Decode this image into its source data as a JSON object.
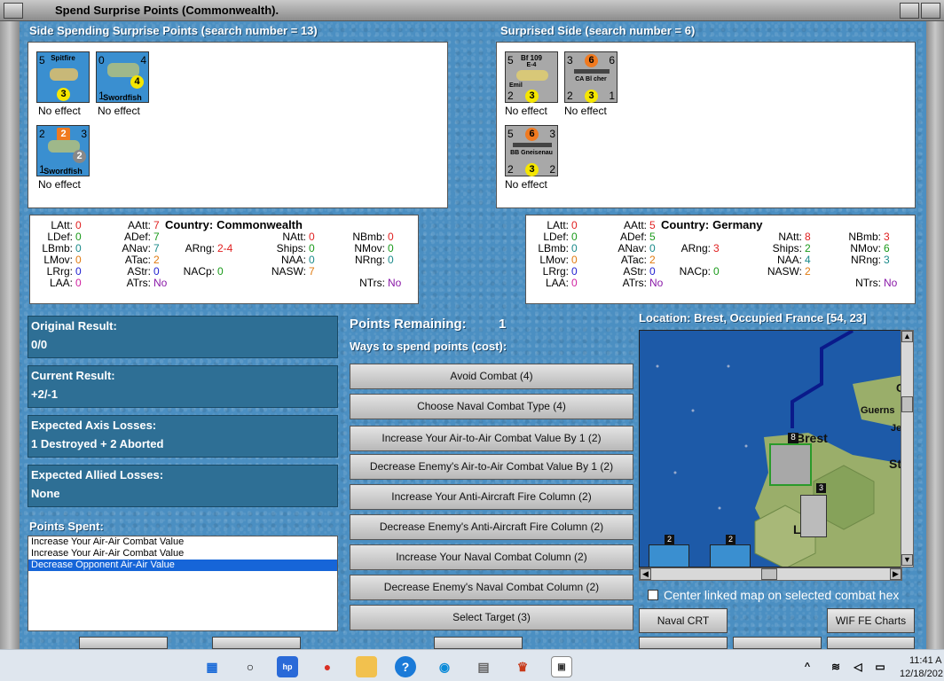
{
  "window": {
    "title": "Spend Surprise Points (Commonwealth)."
  },
  "spending_side": {
    "title": "Side Spending Surprise Points (search number = 13)",
    "units": [
      {
        "name": "Spitfire",
        "tl": "5",
        "mid": "3",
        "effect": "No effect"
      },
      {
        "name": "Swordfish",
        "tl": "0",
        "tr": "4",
        "mid": "4",
        "bl": "1",
        "effect": "No effect"
      },
      {
        "name": "Swordfish",
        "tl": "2",
        "tc": "2",
        "tr": "3",
        "mid": "2",
        "bl": "1",
        "effect": "No effect"
      }
    ]
  },
  "surprised_side": {
    "title": "Surprised Side (search number = 6)",
    "units": [
      {
        "name": "Bf 109",
        "sub": "E-4",
        "extra": "Emil",
        "tl": "5",
        "bl": "2",
        "mid": "3",
        "effect": "No effect"
      },
      {
        "name": "CA Bl cher",
        "tl": "3",
        "tc": "6",
        "tr": "6",
        "bl": "2",
        "mid": "3",
        "br": "1",
        "effect": "No effect"
      },
      {
        "name": "BB Gneisenau",
        "tl": "5",
        "tc": "6",
        "tr": "3",
        "bl": "2",
        "mid": "3",
        "br": "2",
        "effect": "No effect"
      }
    ]
  },
  "stats_left": {
    "country_label": "Country:",
    "country": "Commonwealth",
    "col1": [
      [
        "LAtt:",
        "0"
      ],
      [
        "LDef:",
        "0"
      ],
      [
        "LBmb:",
        "0"
      ],
      [
        "LMov:",
        "0"
      ],
      [
        "LRrg:",
        "0"
      ],
      [
        "LAA:",
        "0"
      ]
    ],
    "col2": [
      [
        "AAtt:",
        "7"
      ],
      [
        "ADef:",
        "7"
      ],
      [
        "ANav:",
        "7"
      ],
      [
        "ATac:",
        "2"
      ],
      [
        "AStr:",
        "0"
      ],
      [
        "ATrs:",
        "No"
      ]
    ],
    "col3": [
      [
        "ARng:",
        "2-4"
      ],
      [
        "NACp:",
        "0"
      ]
    ],
    "col4": [
      [
        "NAtt:",
        "0"
      ],
      [
        "Ships:",
        "0"
      ],
      [
        "NAA:",
        "0"
      ],
      [
        "NASW:",
        "7"
      ]
    ],
    "col5": [
      [
        "NBmb:",
        "0"
      ],
      [
        "NMov:",
        "0"
      ],
      [
        "NRng:",
        "0"
      ],
      [
        "NTrs:",
        "No"
      ]
    ]
  },
  "stats_right": {
    "country_label": "Country:",
    "country": "Germany",
    "col1": [
      [
        "LAtt:",
        "0"
      ],
      [
        "LDef:",
        "0"
      ],
      [
        "LBmb:",
        "0"
      ],
      [
        "LMov:",
        "0"
      ],
      [
        "LRrg:",
        "0"
      ],
      [
        "LAA:",
        "0"
      ]
    ],
    "col2": [
      [
        "AAtt:",
        "5"
      ],
      [
        "ADef:",
        "5"
      ],
      [
        "ANav:",
        "0"
      ],
      [
        "ATac:",
        "2"
      ],
      [
        "AStr:",
        "0"
      ],
      [
        "ATrs:",
        "No"
      ]
    ],
    "col3": [
      [
        "ARng:",
        "3"
      ],
      [
        "NACp:",
        "0"
      ]
    ],
    "col4": [
      [
        "NAtt:",
        "8"
      ],
      [
        "Ships:",
        "2"
      ],
      [
        "NAA:",
        "4"
      ],
      [
        "NASW:",
        "2"
      ]
    ],
    "col5": [
      [
        "NBmb:",
        "3"
      ],
      [
        "NMov:",
        "6"
      ],
      [
        "NRng:",
        "3"
      ],
      [
        "NTrs:",
        "No"
      ]
    ]
  },
  "results": {
    "original_label": "Original Result:",
    "original_value": "0/0",
    "current_label": "Current Result:",
    "current_value": "+2/-1",
    "axis_label": "Expected Axis Losses:",
    "axis_value": "1 Destroyed + 2 Aborted",
    "allied_label": "Expected Allied Losses:",
    "allied_value": "None"
  },
  "points_spent": {
    "label": "Points Spent:",
    "items": [
      "Increase Your Air-Air Combat Value",
      "Increase Your Air-Air Combat Value",
      "Decrease Opponent Air-Air Value"
    ]
  },
  "points": {
    "remaining_label": "Points Remaining:",
    "remaining_value": "1",
    "ways_label": "Ways to spend points (cost):"
  },
  "cost_buttons": [
    "Avoid Combat (4)",
    "Choose Naval Combat Type (4)",
    "Increase Your Air-to-Air Combat Value By 1 (2)",
    "Decrease Enemy's Air-to-Air Combat Value By 1 (2)",
    "Increase Your Anti-Aircraft Fire Column (2)",
    "Decrease Enemy's Anti-Aircraft Fire Column (2)",
    "Increase Your Naval Combat Column (2)",
    "Decrease Enemy's Naval Combat Column (2)",
    "Select Target (3)"
  ],
  "map": {
    "location": "Location: Brest, Occupied France [54, 23]",
    "labels": {
      "brest": "Brest",
      "guerns": "Guerns",
      "je": "Je",
      "st": "St",
      "c": "C",
      "l": "L"
    },
    "unit_counts": {
      "a": "8",
      "b": "3",
      "c": "2",
      "d": "2"
    },
    "center_label": "Center linked map on selected combat hex"
  },
  "bottom_buttons": {
    "naval_crt": "Naval CRT",
    "wif_charts": "WIF FE Charts"
  },
  "taskbar": {
    "time": "11:41 A",
    "date": "12/18/202"
  },
  "colors": {
    "panel_blue": "#2e6f95",
    "zero_red": "#e02020",
    "green": "#1a9a1a",
    "teal": "#1a8a8a",
    "orange": "#e07a10",
    "blue": "#2020d0",
    "purple": "#8a1aa8",
    "pink": "#d020a0"
  }
}
